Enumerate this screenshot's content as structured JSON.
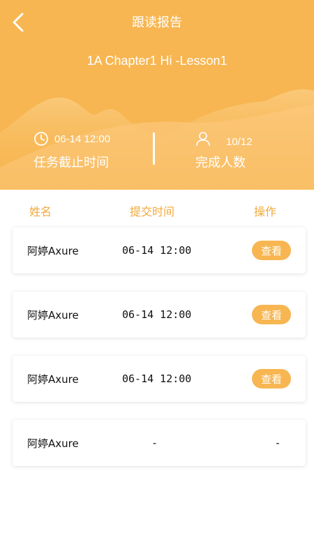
{
  "header": {
    "title": "跟读报告",
    "subtitle": "1A Chapter1 Hi -Lesson1",
    "deadline": {
      "value": "06-14 12:00",
      "label": "任务截止时间",
      "icon": "clock-icon"
    },
    "completed": {
      "value": "10/12",
      "label": "完成人数",
      "icon": "user-icon"
    },
    "colors": {
      "primary": "#f7b651",
      "accent_text": "#f2a93b"
    }
  },
  "columns": {
    "name": "姓名",
    "time": "提交时间",
    "action": "操作"
  },
  "rows": [
    {
      "name": "阿婷Axure",
      "time": "06-14 12:00",
      "action": "查看"
    },
    {
      "name": "阿婷Axure",
      "time": "06-14 12:00",
      "action": "查看"
    },
    {
      "name": "阿婷Axure",
      "time": "06-14 12:00",
      "action": "查看"
    },
    {
      "name": "阿婷Axure",
      "time": "-",
      "action": "-"
    }
  ]
}
